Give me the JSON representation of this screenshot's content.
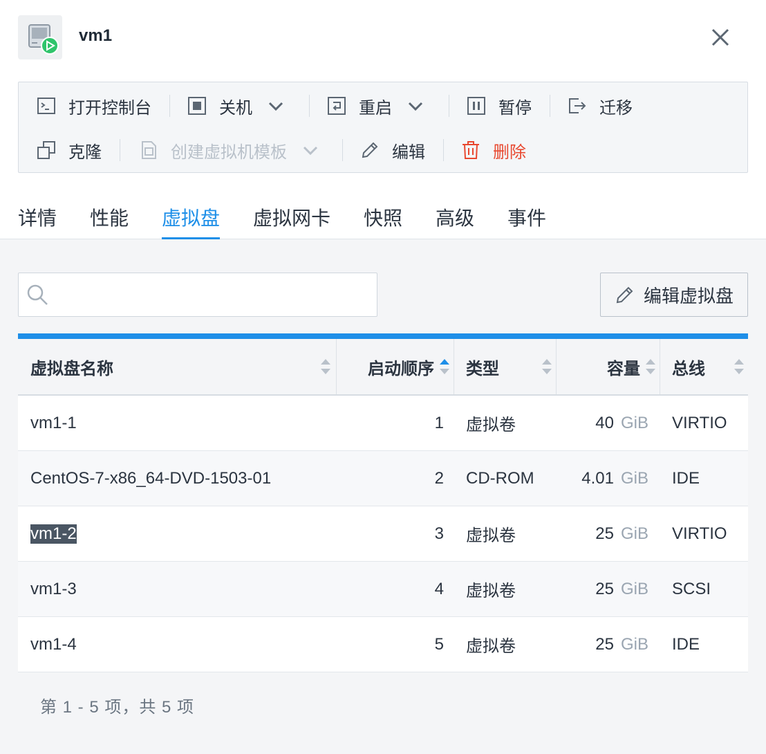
{
  "header": {
    "title": "vm1",
    "vm_icon": "vm-running-icon",
    "close_icon": "close-icon"
  },
  "toolbar": {
    "open_console": "打开控制台",
    "shutdown": "关机",
    "restart": "重启",
    "pause": "暂停",
    "migrate": "迁移",
    "clone": "克隆",
    "create_template": "创建虚拟机模板",
    "edit": "编辑",
    "delete": "删除"
  },
  "tabs": [
    "详情",
    "性能",
    "虚拟盘",
    "虚拟网卡",
    "快照",
    "高级",
    "事件"
  ],
  "active_tab": "虚拟盘",
  "search": {
    "placeholder": "",
    "value": ""
  },
  "edit_disk_button": "编辑虚拟盘",
  "table": {
    "columns": [
      "虚拟盘名称",
      "启动顺序",
      "类型",
      "容量",
      "总线"
    ],
    "rows": [
      {
        "name": "vm1-1",
        "boot_order": "1",
        "type": "虚拟卷",
        "capacity": "40",
        "unit": "GiB",
        "bus": "VIRTIO"
      },
      {
        "name": "CentOS-7-x86_64-DVD-1503-01",
        "boot_order": "2",
        "type": "CD-ROM",
        "capacity": "4.01",
        "unit": "GiB",
        "bus": "IDE"
      },
      {
        "name": "vm1-2",
        "boot_order": "3",
        "type": "虚拟卷",
        "capacity": "25",
        "unit": "GiB",
        "bus": "VIRTIO"
      },
      {
        "name": "vm1-3",
        "boot_order": "4",
        "type": "虚拟卷",
        "capacity": "25",
        "unit": "GiB",
        "bus": "SCSI"
      },
      {
        "name": "vm1-4",
        "boot_order": "5",
        "type": "虚拟卷",
        "capacity": "25",
        "unit": "GiB",
        "bus": "IDE"
      }
    ]
  },
  "pagination": "第 1 - 5 项，共 5 项",
  "colors": {
    "accent": "#1e8fe8",
    "danger": "#e8482f",
    "running": "#2fc46b"
  }
}
